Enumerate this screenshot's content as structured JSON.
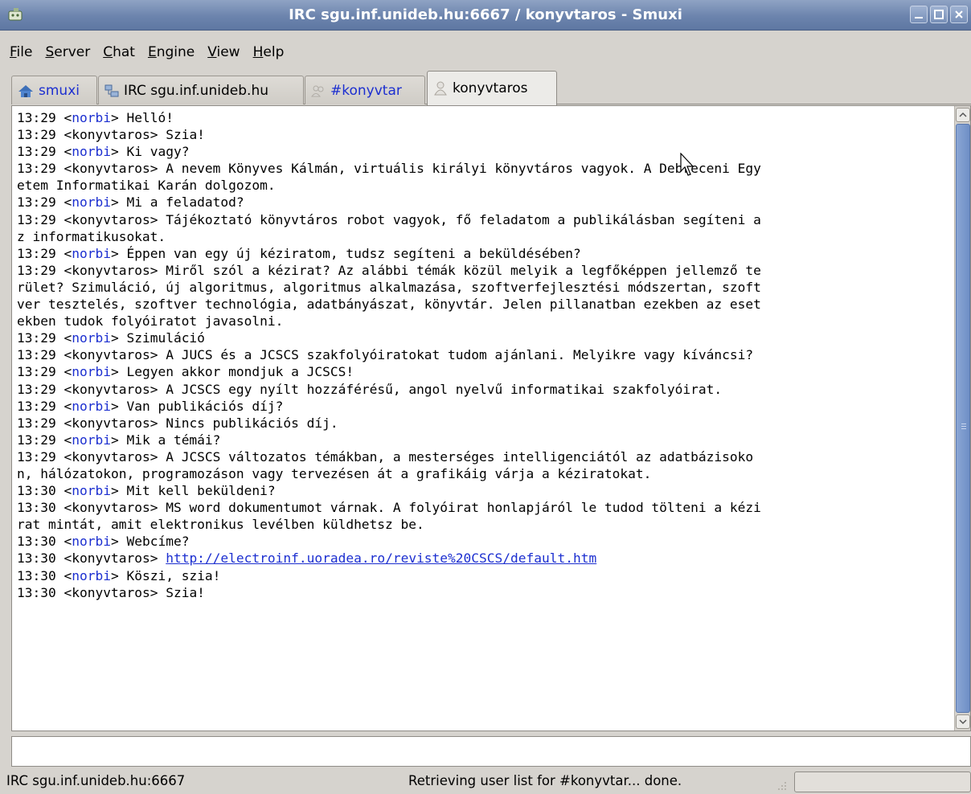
{
  "window": {
    "title": "IRC sgu.inf.unideb.hu:6667 / konyvtaros - Smuxi",
    "app_icon": "smuxi-app-icon",
    "buttons": [
      "minimize-icon",
      "maximize-icon",
      "close-icon"
    ]
  },
  "menu": {
    "items": [
      {
        "mnemonic": "F",
        "rest": "ile"
      },
      {
        "mnemonic": "S",
        "rest": "erver"
      },
      {
        "mnemonic": "C",
        "rest": "hat"
      },
      {
        "mnemonic": "E",
        "rest": "ngine"
      },
      {
        "mnemonic": "V",
        "rest": "iew"
      },
      {
        "mnemonic": "H",
        "rest": "elp"
      }
    ]
  },
  "tabs": [
    {
      "label": "smuxi",
      "icon": "home-icon"
    },
    {
      "label": "IRC sgu.inf.unideb.hu",
      "icon": "network-icon"
    },
    {
      "label": "#konyvtar",
      "icon": "group-icon"
    },
    {
      "label": "konyvtaros",
      "icon": "person-icon"
    }
  ],
  "chat": {
    "lines": [
      {
        "time": "13:29",
        "nick": "norbi",
        "text": "Helló!"
      },
      {
        "time": "13:29",
        "nick": "konyvtaros",
        "text": "Szia!"
      },
      {
        "time": "13:29",
        "nick": "norbi",
        "text": "Ki vagy?"
      },
      {
        "time": "13:29",
        "nick": "konyvtaros",
        "text": "A nevem Könyves Kálmán, virtuális királyi könyvtáros vagyok. A Debreceni Egy"
      },
      {
        "time": "",
        "nick": "",
        "text": "etem Informatikai Karán dolgozom."
      },
      {
        "time": "13:29",
        "nick": "norbi",
        "text": "Mi a feladatod?"
      },
      {
        "time": "13:29",
        "nick": "konyvtaros",
        "text": "Tájékoztató könyvtáros robot vagyok, fő feladatom a publikálásban segíteni a"
      },
      {
        "time": "",
        "nick": "",
        "text": "z informatikusokat."
      },
      {
        "time": "13:29",
        "nick": "norbi",
        "text": "Éppen van egy új kéziratom, tudsz segíteni a beküldésében?"
      },
      {
        "time": "13:29",
        "nick": "konyvtaros",
        "text": "Miről szól a kézirat? Az alábbi témák közül melyik a legfőképpen jellemző te"
      },
      {
        "time": "",
        "nick": "",
        "text": "rület? Szimuláció, új algoritmus, algoritmus alkalmazása, szoftverfejlesztési módszertan, szoft"
      },
      {
        "time": "",
        "nick": "",
        "text": "ver tesztelés, szoftver technológia, adatbányászat, könyvtár. Jelen pillanatban ezekben az eset"
      },
      {
        "time": "",
        "nick": "",
        "text": "ekben tudok folyóiratot javasolni."
      },
      {
        "time": "13:29",
        "nick": "norbi",
        "text": "Szimuláció"
      },
      {
        "time": "13:29",
        "nick": "konyvtaros",
        "text": "A JUCS és a JCSCS szakfolyóiratokat tudom ajánlani. Melyikre vagy kíváncsi?"
      },
      {
        "time": "13:29",
        "nick": "norbi",
        "text": "Legyen akkor mondjuk a JCSCS!"
      },
      {
        "time": "13:29",
        "nick": "konyvtaros",
        "text": "A JCSCS egy nyílt hozzáférésű, angol nyelvű informatikai szakfolyóirat."
      },
      {
        "time": "13:29",
        "nick": "norbi",
        "text": "Van publikációs díj?"
      },
      {
        "time": "13:29",
        "nick": "konyvtaros",
        "text": "Nincs publikációs díj."
      },
      {
        "time": "13:29",
        "nick": "norbi",
        "text": "Mik a témái?"
      },
      {
        "time": "13:29",
        "nick": "konyvtaros",
        "text": "A JCSCS változatos témákban, a mesterséges intelligenciától az adatbázisoko"
      },
      {
        "time": "",
        "nick": "",
        "text": "n, hálózatokon, programozáson vagy tervezésen át a grafikáig várja a kéziratokat."
      },
      {
        "time": "13:30",
        "nick": "norbi",
        "text": "Mit kell beküldeni?"
      },
      {
        "time": "13:30",
        "nick": "konyvtaros",
        "text": "MS word dokumentumot várnak. A folyóirat honlapjáról le tudod tölteni a kézi"
      },
      {
        "time": "",
        "nick": "",
        "text": "rat mintát, amit elektronikus levélben küldhetsz be."
      },
      {
        "time": "13:30",
        "nick": "norbi",
        "text": "Webcíme?"
      },
      {
        "time": "13:30",
        "nick": "konyvtaros",
        "text": "",
        "link": "http://electroinf.uoradea.ro/reviste%20CSCS/default.htm"
      },
      {
        "time": "13:30",
        "nick": "norbi",
        "text": "Köszi, szia!"
      },
      {
        "time": "13:30",
        "nick": "konyvtaros",
        "text": "Szia!"
      }
    ]
  },
  "input": {
    "value": ""
  },
  "status": {
    "server": "IRC sgu.inf.unideb.hu:6667",
    "message": "Retrieving user list for #konyvtar... done."
  },
  "colors": {
    "nick_self": "#1c2fd0",
    "link": "#1c2fd0",
    "titlebar": "#6c84ad"
  }
}
